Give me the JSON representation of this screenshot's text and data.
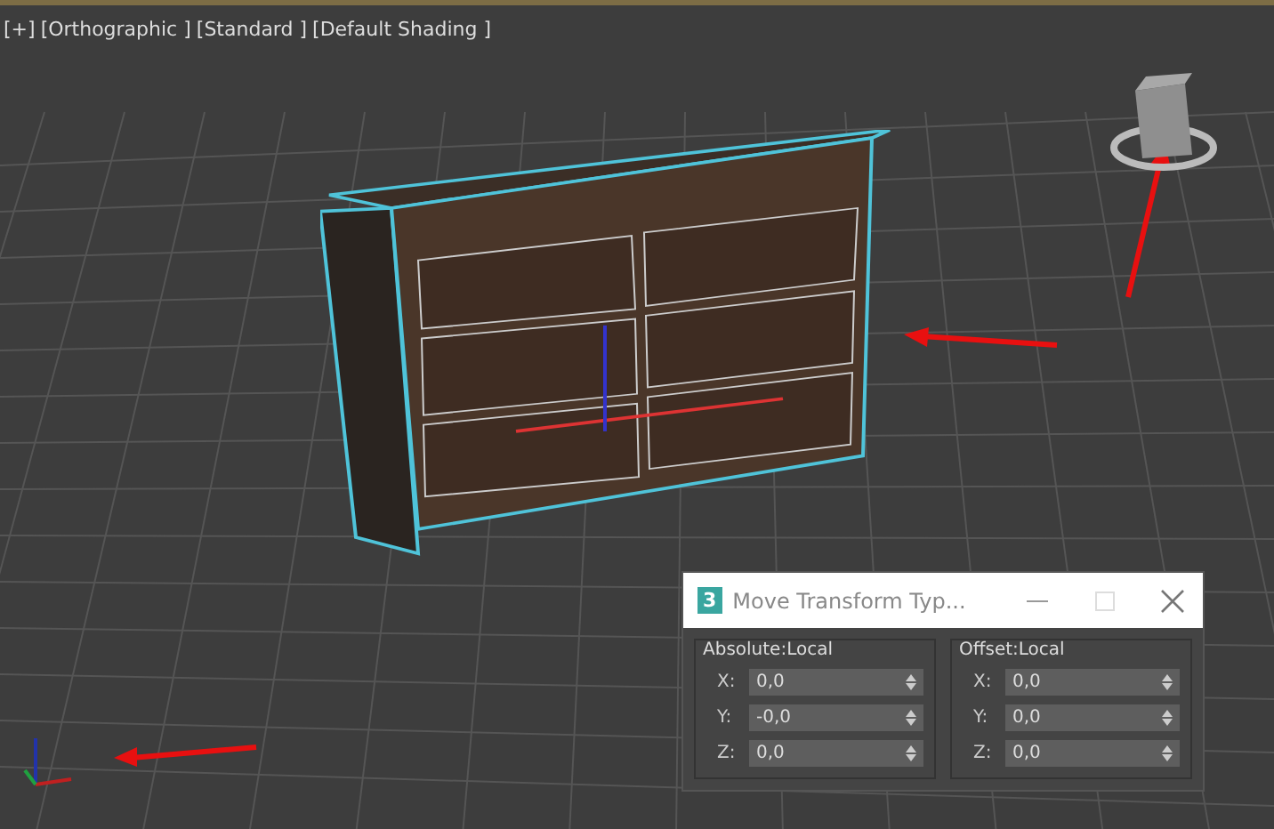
{
  "viewport": {
    "labels": [
      "[+]",
      "[Orthographic ]",
      "[Standard ]",
      "[Default Shading ]"
    ]
  },
  "dialog": {
    "title": "Move Transform Typ...",
    "app_badge": "3",
    "groups": [
      {
        "title": "Absolute:Local",
        "fields": [
          {
            "axis": "X:",
            "value": "0,0"
          },
          {
            "axis": "Y:",
            "value": "-0,0"
          },
          {
            "axis": "Z:",
            "value": "0,0"
          }
        ]
      },
      {
        "title": "Offset:Local",
        "fields": [
          {
            "axis": "X:",
            "value": "0,0"
          },
          {
            "axis": "Y:",
            "value": "0,0"
          },
          {
            "axis": "Z:",
            "value": "0,0"
          }
        ]
      }
    ]
  }
}
